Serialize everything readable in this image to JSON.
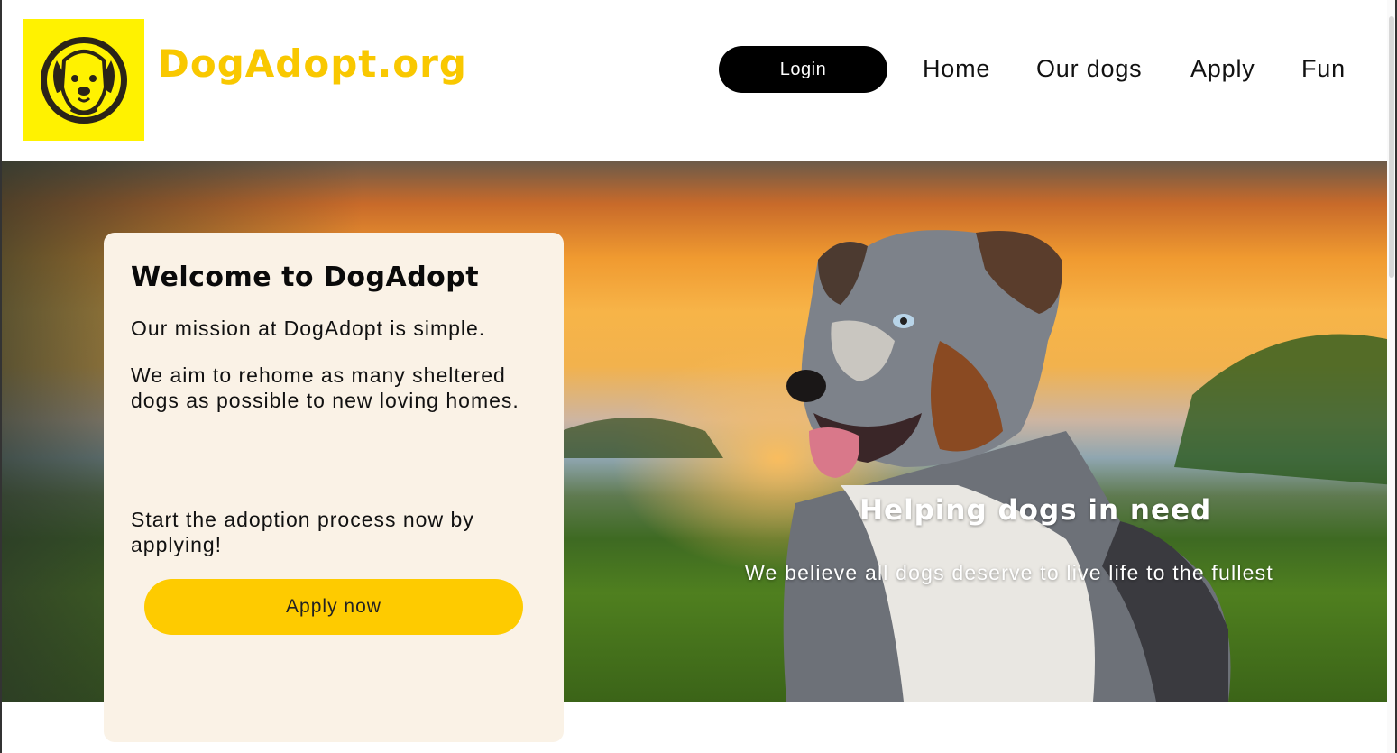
{
  "header": {
    "brand": "DogAdopt.org",
    "logo_icon": "dog-face-icon",
    "logo_bg": "#fff200",
    "brand_color": "#f9c800"
  },
  "nav": {
    "login": "Login",
    "links": [
      "Home",
      "Our dogs",
      "Apply",
      "Fun"
    ]
  },
  "hero": {
    "title": "Helping dogs in need",
    "subtitle": "We believe all dogs deserve to live life to the fullest"
  },
  "card": {
    "title": "Welcome to DogAdopt",
    "p1": "Our mission at DogAdopt is simple.",
    "p2": "We aim to rehome as many sheltered dogs as possible to new loving homes.",
    "p3": "Start the adoption process now by applying!",
    "button": "Apply now",
    "button_color": "#fecb00"
  }
}
